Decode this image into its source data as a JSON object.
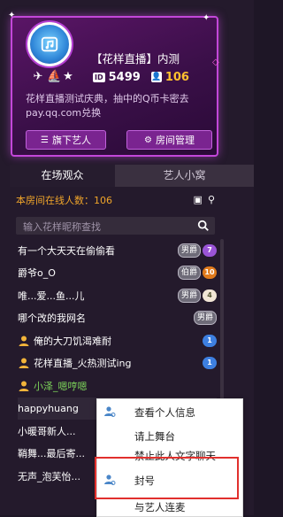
{
  "header": {
    "title_part1": "【花样直播】",
    "title_part2": "内测",
    "room_id_tag": "ID",
    "room_id": "5499",
    "fans_count": "106",
    "notice_line1": "花样直播测试庆典，抽中的Q币卡密去",
    "notice_line2": "pay.qq.com兑换",
    "buttons": {
      "artists": "旗下艺人",
      "manage": "房间管理"
    }
  },
  "tabs": [
    {
      "label": "在场观众",
      "active": true
    },
    {
      "label": "艺人小窝",
      "active": false
    }
  ],
  "online": {
    "label": "本房间在线人数：106"
  },
  "search": {
    "placeholder": "输入花样昵称查找"
  },
  "users": [
    {
      "name": "有一个大天天在偷偷看",
      "rank": "男爵",
      "level": "7",
      "level_color": "purple"
    },
    {
      "name": "爵爷o_O",
      "rank": "伯爵",
      "level": "10",
      "level_color": "orange"
    },
    {
      "name": "唯...爱...鱼...儿",
      "rank": "男爵",
      "level": "4",
      "level_color": "face"
    },
    {
      "name": "哪个改的我网名",
      "rank": "男爵",
      "level": "",
      "level_color": ""
    },
    {
      "name": "俺的大刀饥渴难耐",
      "rank": "",
      "level": "1",
      "level_color": "blue",
      "crown": true
    },
    {
      "name": "花样直播_火热测试ing",
      "rank": "",
      "level": "1",
      "level_color": "blue",
      "crown": true
    },
    {
      "name": "小泽_嗯哼嗯",
      "rank": "",
      "level": "",
      "level_color": "",
      "crown": true,
      "green": true
    },
    {
      "name": "happyhuang",
      "rank": "",
      "level": "",
      "level_color": "",
      "selected": true
    },
    {
      "name": "小暖哥新人...",
      "rank": "",
      "level": "",
      "level_color": ""
    },
    {
      "name": "鞘舞...最后寄...",
      "rank": "",
      "level": "",
      "level_color": ""
    },
    {
      "name": "无声_泡芙怡...",
      "rank": "",
      "level": "",
      "level_color": ""
    }
  ],
  "context_menu": {
    "items": [
      {
        "label": "查看个人信息"
      },
      {
        "label": "请上舞台"
      },
      {
        "label": "禁止此人文字聊天"
      },
      {
        "label": "封号"
      },
      {
        "label": "与艺人连麦"
      }
    ]
  },
  "colors": {
    "accent_magenta": "#c347d9",
    "online_text": "#f0a52a",
    "fans_value": "#ffc12e",
    "highlight_box": "#e1302d"
  }
}
